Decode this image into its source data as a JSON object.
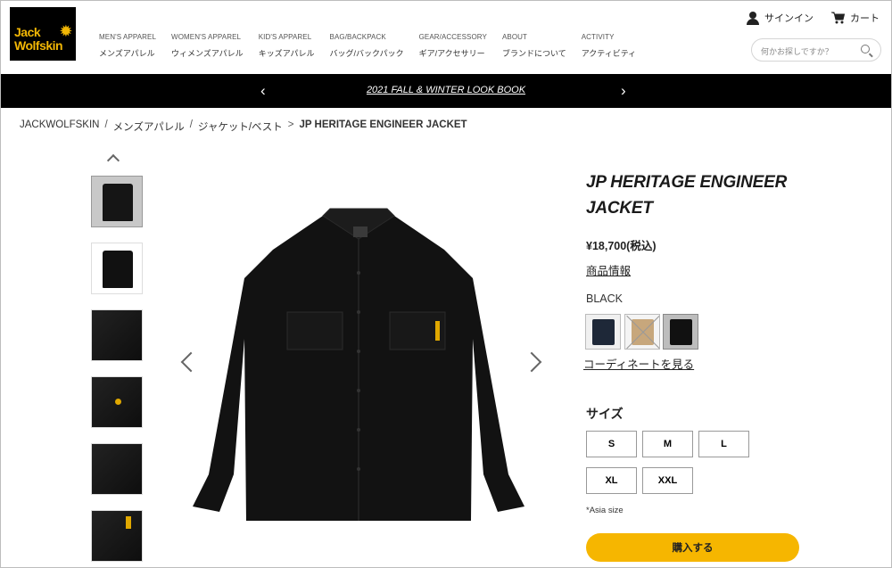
{
  "brand": {
    "logo_line1": "Jack",
    "logo_line2": "Wolfskin"
  },
  "nav": [
    {
      "en": "MEN'S APPAREL",
      "ja": "メンズアパレル"
    },
    {
      "en": "WOMEN'S APPAREL",
      "ja": "ウィメンズアパレル"
    },
    {
      "en": "KID'S APPAREL",
      "ja": "キッズアパレル"
    },
    {
      "en": "BAG/BACKPACK",
      "ja": "バッグ/バックパック"
    },
    {
      "en": "GEAR/ACCESSORY",
      "ja": "ギア/アクセサリー"
    },
    {
      "en": "ABOUT",
      "ja": "ブランドについて"
    },
    {
      "en": "ACTIVITY",
      "ja": "アクティビティ"
    }
  ],
  "utility": {
    "signin": "サインイン",
    "cart": "カート"
  },
  "search": {
    "placeholder": "何かお探しですか？"
  },
  "promo": {
    "text": "2021 FALL & WINTER LOOK BOOK",
    "prev": "‹",
    "next": "›"
  },
  "breadcrumb": {
    "items": [
      "JACKWOLFSKIN",
      "メンズアパレル",
      "ジャケット/ベスト"
    ],
    "separators": [
      "/",
      "/",
      ">"
    ],
    "current": "JP HERITAGE ENGINEER JACKET"
  },
  "product": {
    "title": "JP HERITAGE ENGINEER JACKET",
    "price": "¥18,700(税込)",
    "info_link": "商品情報",
    "selected_color": "BLACK",
    "colors": [
      "navy",
      "beige",
      "black"
    ],
    "coordinate_link": "コーディネートを見る",
    "size_label": "サイズ",
    "sizes": [
      "S",
      "M",
      "L",
      "XL",
      "XXL"
    ],
    "size_note": "*Asia size",
    "buy_label": "購入する"
  },
  "colors": {
    "accent": "#f6b600",
    "promo_bg": "#000000",
    "logo_yellow": "#f2b705"
  }
}
